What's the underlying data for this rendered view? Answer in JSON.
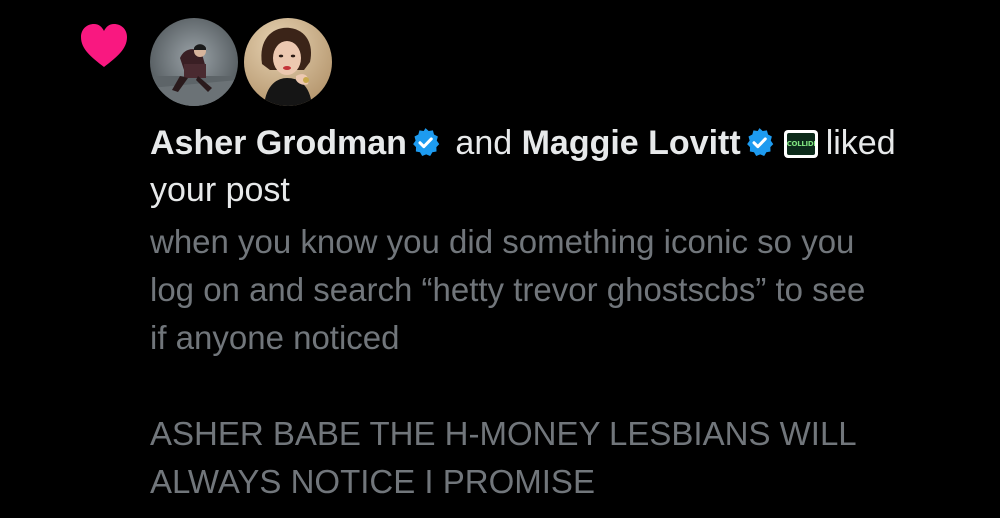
{
  "notification": {
    "type_icon": "heart-icon",
    "type_color": "#f91880",
    "avatars": [
      {
        "name": "avatar-asher",
        "icon": "person-on-stairs"
      },
      {
        "name": "avatar-maggie",
        "icon": "person-portrait"
      }
    ],
    "user1": {
      "name": "Asher Grodman",
      "verified": true
    },
    "connector": "and",
    "user2": {
      "name": "Maggie Lovitt",
      "verified": true,
      "affiliate_badge": "COLLIDER"
    },
    "action_word": "liked",
    "action_rest": "your post",
    "verified_color": "#1d9bf0",
    "post": {
      "lines": [
        "when you know you did something iconic so you",
        "log on and search “hetty trevor ghostscbs” to see",
        "if anyone noticed"
      ],
      "lines2": [
        "ASHER BABE THE H-MONEY LESBIANS WILL",
        "ALWAYS NOTICE I PROMISE"
      ]
    }
  }
}
